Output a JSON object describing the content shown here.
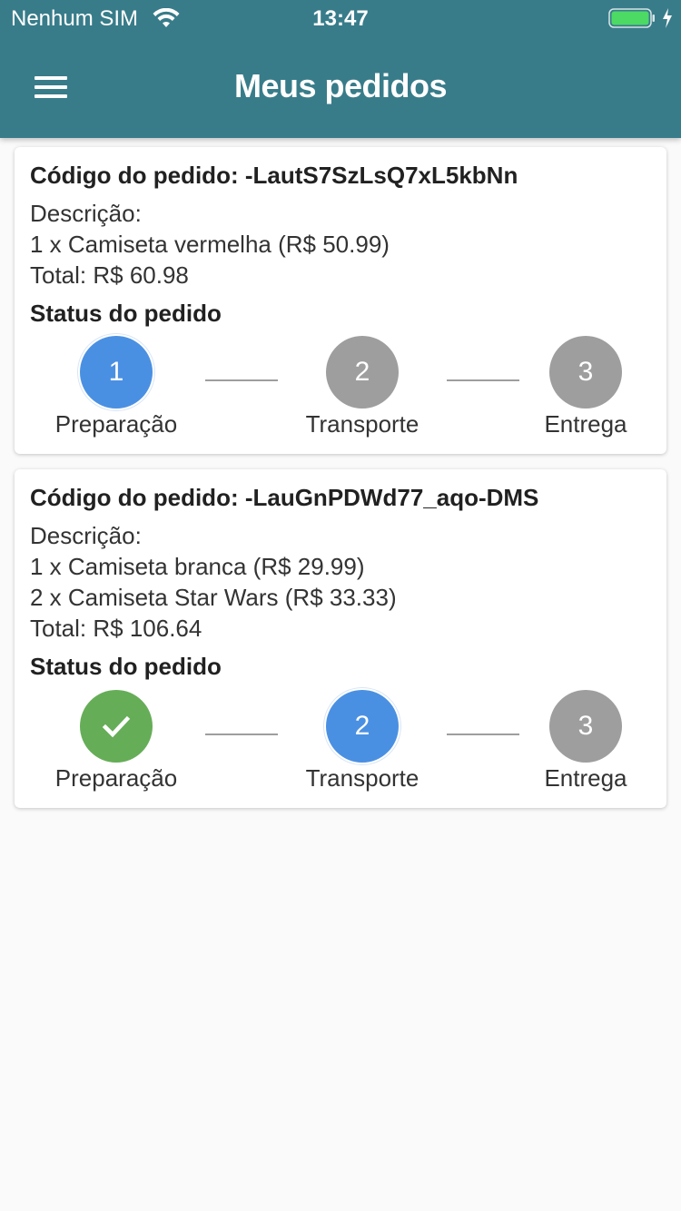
{
  "status_bar": {
    "carrier": "Nenhum SIM",
    "time": "13:47"
  },
  "appbar": {
    "title": "Meus pedidos",
    "menu_icon": "menu-icon"
  },
  "colors": {
    "appbar": "#387c8a",
    "active_step": "#4a90e2",
    "pending_step": "#9e9e9e",
    "done_step": "#66ad58",
    "battery": "#4cd964"
  },
  "orders": [
    {
      "code_label": "Código do pedido: -LautS7SzLsQ7xL5kbNn",
      "description_label": "Descrição:",
      "items": [
        "1 x Camiseta vermelha (R$ 50.99)"
      ],
      "total": "Total: R$ 60.98",
      "status_title": "Status do pedido",
      "steps": [
        {
          "number": "1",
          "label": "Preparação",
          "state": "active"
        },
        {
          "number": "2",
          "label": "Transporte",
          "state": "pending"
        },
        {
          "number": "3",
          "label": "Entrega",
          "state": "pending"
        }
      ]
    },
    {
      "code_label": "Código do pedido: -LauGnPDWd77_aqo-DMS",
      "description_label": "Descrição:",
      "items": [
        "1 x Camiseta branca (R$ 29.99)",
        "2 x Camiseta Star Wars (R$ 33.33)"
      ],
      "total": "Total: R$ 106.64",
      "status_title": "Status do pedido",
      "steps": [
        {
          "number": "✓",
          "label": "Preparação",
          "state": "done"
        },
        {
          "number": "2",
          "label": "Transporte",
          "state": "active"
        },
        {
          "number": "3",
          "label": "Entrega",
          "state": "pending"
        }
      ]
    }
  ]
}
